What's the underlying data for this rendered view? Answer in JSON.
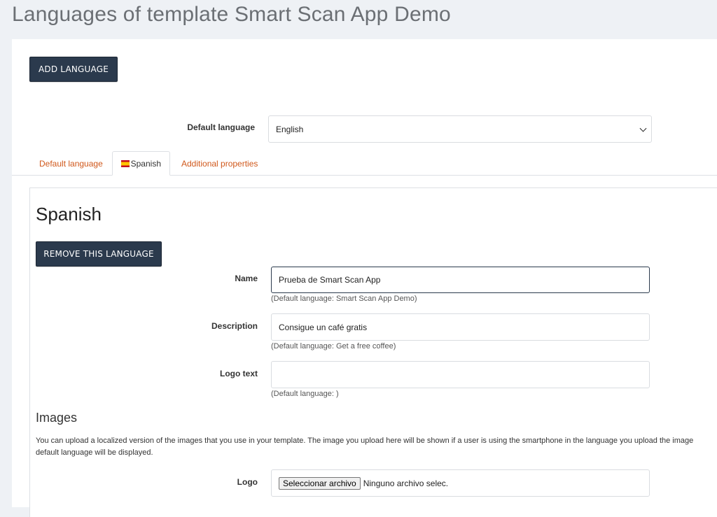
{
  "page": {
    "title": "Languages of template Smart Scan App Demo"
  },
  "toolbar": {
    "add_language_label": "ADD LANGUAGE"
  },
  "default_language": {
    "label": "Default language",
    "selected": "English"
  },
  "tabs": [
    {
      "label": "Default language",
      "active": false
    },
    {
      "label": "Spanish",
      "active": true,
      "icon": "spain-flag-icon"
    },
    {
      "label": "Additional properties",
      "active": false
    }
  ],
  "panel": {
    "heading": "Spanish",
    "remove_label": "REMOVE THIS LANGUAGE",
    "fields": {
      "name": {
        "label": "Name",
        "value": "Prueba de Smart Scan App",
        "help": "(Default language: Smart Scan App Demo)"
      },
      "description": {
        "label": "Description",
        "value": "Consigue un café gratis",
        "help": "(Default language: Get a free coffee)"
      },
      "logo_text": {
        "label": "Logo text",
        "value": "",
        "help": "(Default language: )"
      }
    },
    "images": {
      "heading": "Images",
      "text_line1": "You can upload a localized version of the images that you use in your template. The image you upload here will be shown if a user is using the smartphone in the language you upload the image",
      "text_line2": "default language will be displayed.",
      "logo": {
        "label": "Logo",
        "button": "Seleccionar archivo",
        "status": "Ninguno archivo selec."
      }
    }
  },
  "colors": {
    "accent": "#d0581b",
    "dark_button": "#2b3a4d",
    "background": "#eef1f5"
  }
}
